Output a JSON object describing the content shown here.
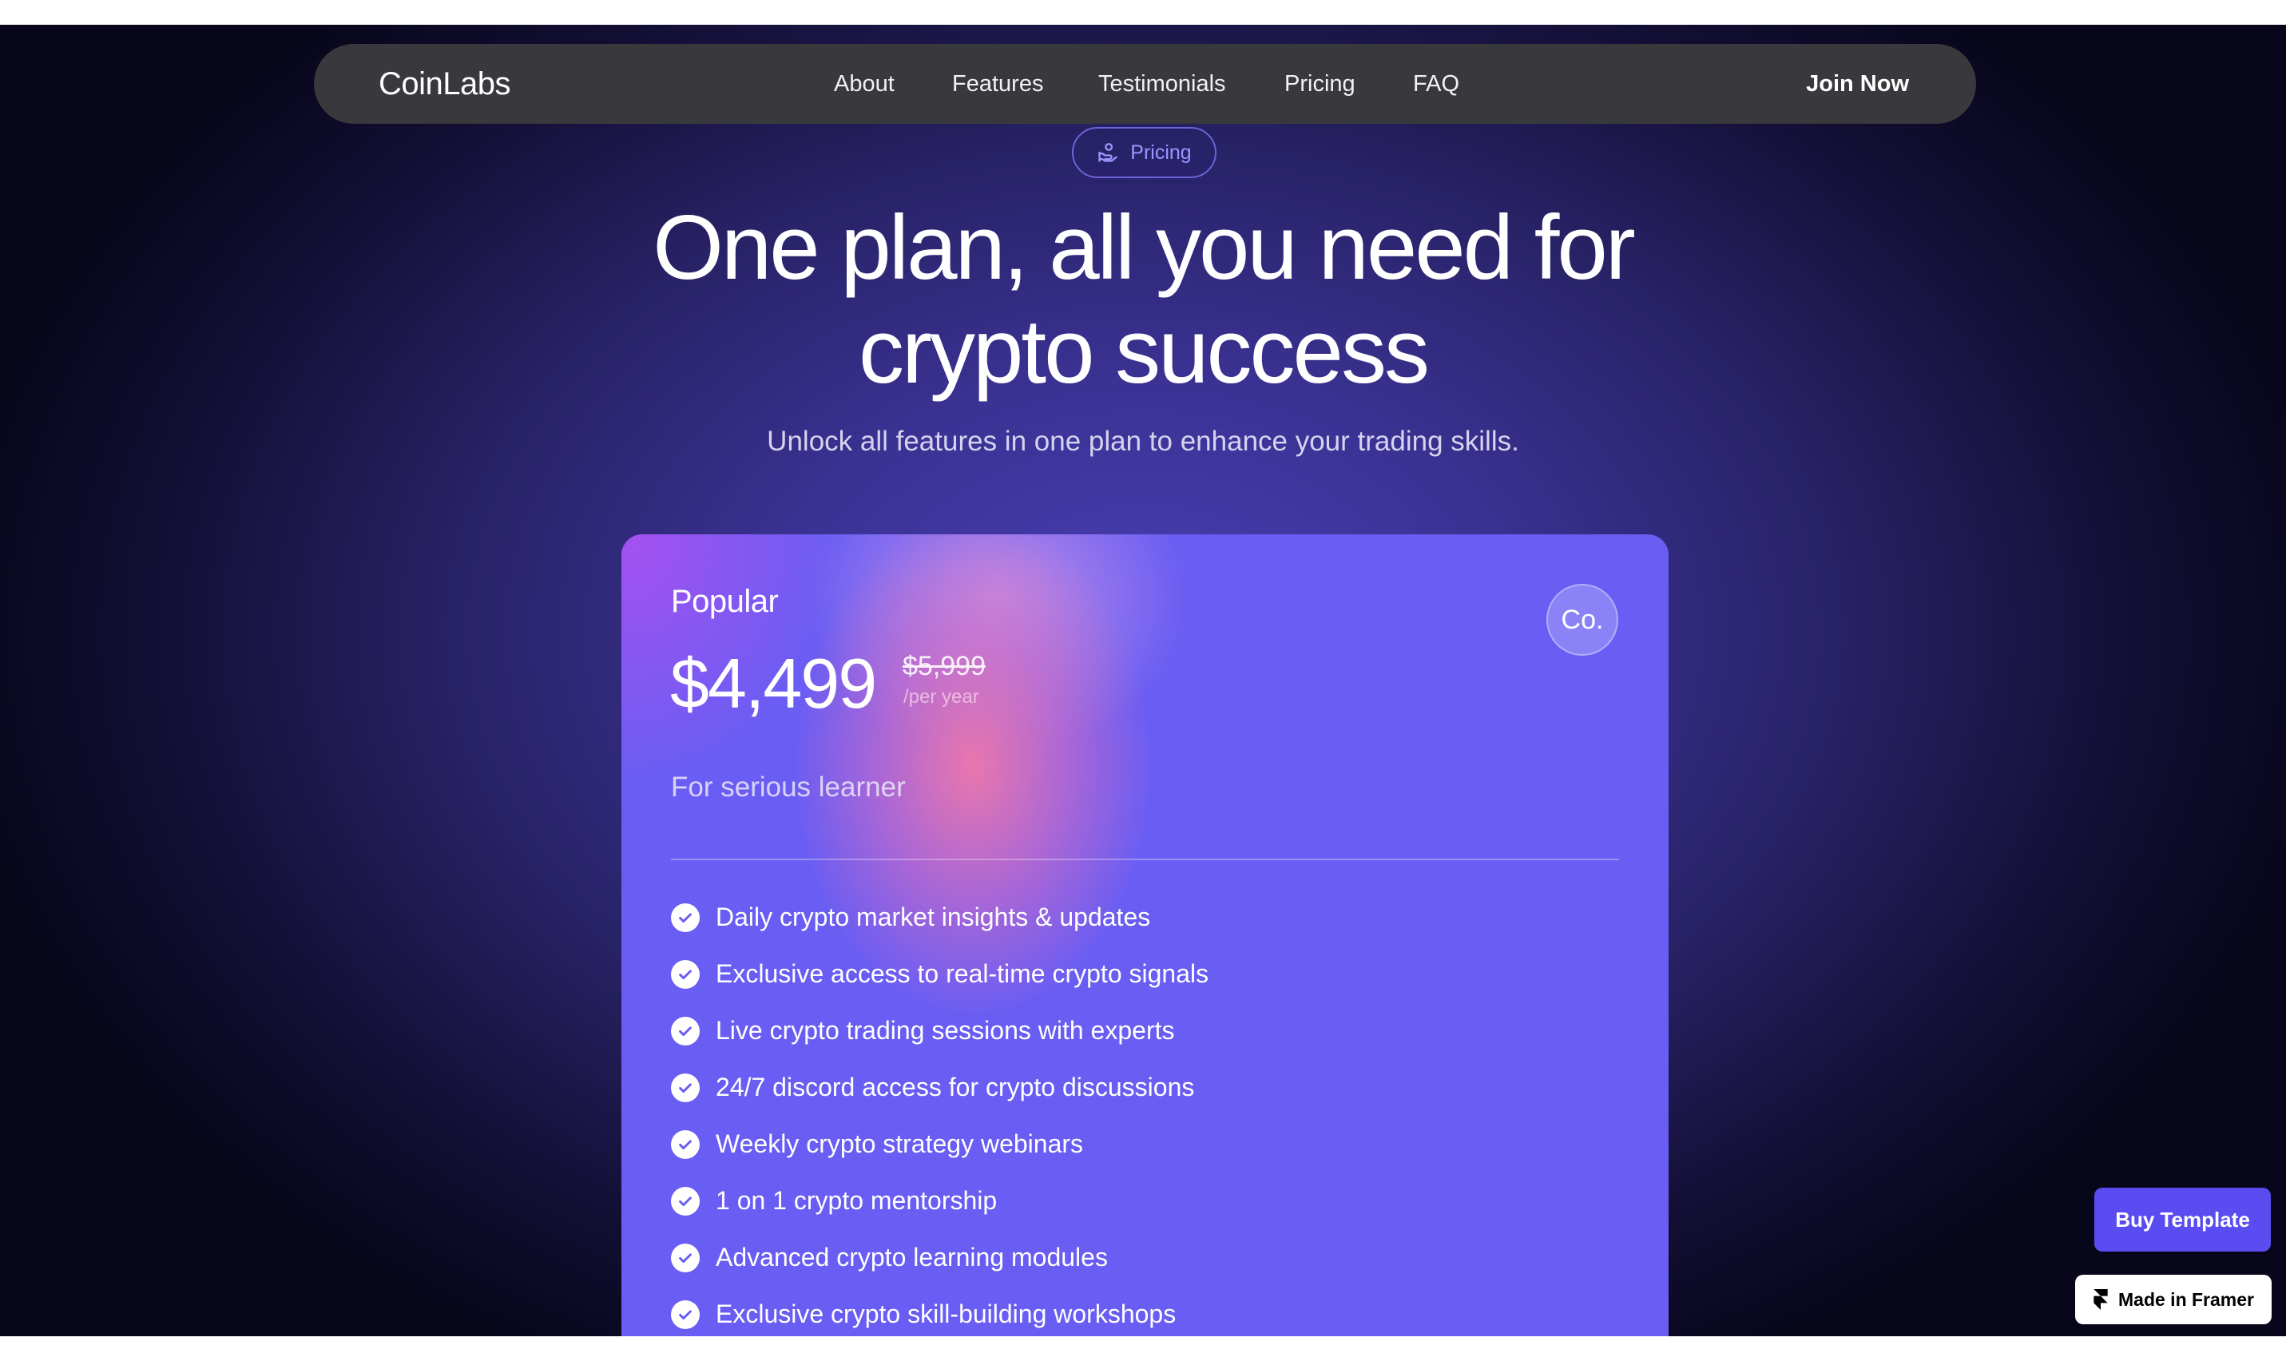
{
  "nav": {
    "logo": "CoinLabs",
    "links": [
      "About",
      "Features",
      "Testimonials",
      "Pricing",
      "FAQ"
    ],
    "cta": "Join Now"
  },
  "hero": {
    "pill_label": "Pricing",
    "pill_icon": "hand-coin-icon",
    "headline_line1": "One plan, all you need for",
    "headline_line2": "crypto success",
    "subheadline": "Unlock all features in one plan to enhance your trading skills."
  },
  "plan": {
    "name": "Popular",
    "price": "$4,499",
    "old_price": "$5,999",
    "period": "/per year",
    "tagline": "For serious learner",
    "badge": "Co.",
    "features": [
      "Daily crypto market insights & updates",
      "Exclusive access to real-time crypto signals",
      "Live crypto trading sessions with experts",
      "24/7 discord access for crypto discussions",
      "Weekly crypto strategy webinars",
      "1 on 1 crypto mentorship",
      "Advanced crypto learning modules",
      "Exclusive crypto skill-building workshops"
    ]
  },
  "floating": {
    "buy_template": "Buy Template",
    "made_in_framer": "Made in Framer"
  },
  "colors": {
    "nav_bg": "#38383d",
    "card_bg": "#6a5df3",
    "accent": "#5a4cf0",
    "pill_text": "#9d95ff"
  }
}
